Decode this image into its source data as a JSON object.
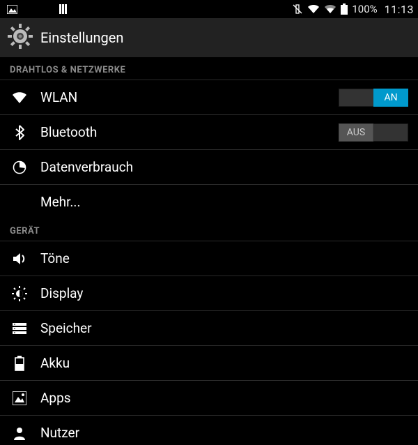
{
  "status": {
    "battery_text": "100%",
    "clock": "11:13"
  },
  "header": {
    "title": "Einstellungen"
  },
  "sections": {
    "wireless": {
      "title": "DRAHTLOS & NETZWERKE",
      "wlan": {
        "label": "WLAN",
        "toggle": {
          "state": "on",
          "on": "AN",
          "off": "AUS"
        }
      },
      "bluetooth": {
        "label": "Bluetooth",
        "toggle": {
          "state": "off",
          "on": "AN",
          "off": "AUS"
        }
      },
      "data": {
        "label": "Datenverbrauch"
      },
      "more": {
        "label": "Mehr..."
      }
    },
    "device": {
      "title": "GERÄT",
      "sound": {
        "label": "Töne"
      },
      "display": {
        "label": "Display"
      },
      "storage": {
        "label": "Speicher"
      },
      "battery": {
        "label": "Akku"
      },
      "apps": {
        "label": "Apps"
      },
      "users": {
        "label": "Nutzer"
      }
    }
  }
}
